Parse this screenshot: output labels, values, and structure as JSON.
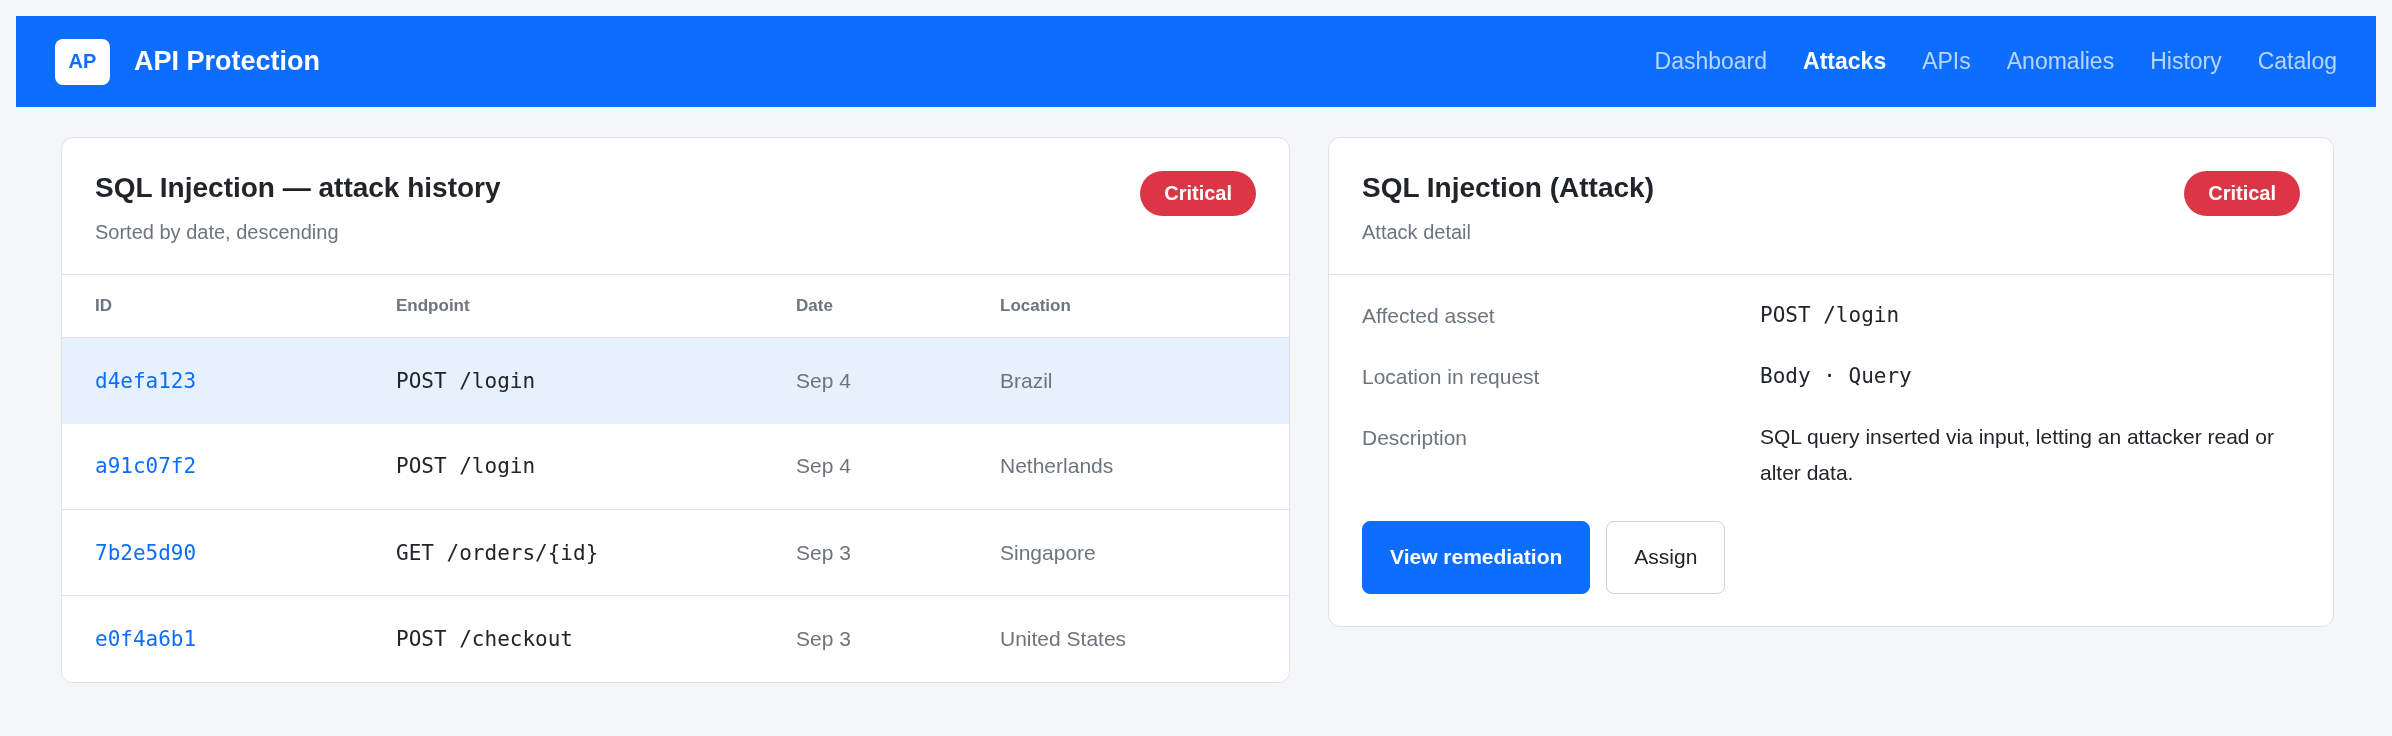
{
  "header": {
    "logo": "AP",
    "title": "API Protection",
    "nav": [
      {
        "label": "Dashboard",
        "selected": false
      },
      {
        "label": "Attacks",
        "selected": true
      },
      {
        "label": "APIs",
        "selected": false
      },
      {
        "label": "Anomalies",
        "selected": false
      },
      {
        "label": "History",
        "selected": false
      },
      {
        "label": "Catalog",
        "selected": false
      }
    ]
  },
  "history": {
    "title": "SQL Injection — attack history",
    "subtitle": "Sorted by date, descending",
    "badge": "Critical",
    "table": {
      "columns": [
        "ID",
        "Endpoint",
        "Date",
        "Location"
      ],
      "rows": [
        {
          "id": "d4efa123",
          "endpoint": "POST /login",
          "date": "Sep 4",
          "location": "Brazil",
          "selected": true
        },
        {
          "id": "a91c07f2",
          "endpoint": "POST /login",
          "date": "Sep 4",
          "location": "Netherlands",
          "selected": false
        },
        {
          "id": "7b2e5d90",
          "endpoint": "GET /orders/{id}",
          "date": "Sep 3",
          "location": "Singapore",
          "selected": false
        },
        {
          "id": "e0f4a6b1",
          "endpoint": "POST /checkout",
          "date": "Sep 3",
          "location": "United States",
          "selected": false
        }
      ]
    }
  },
  "detail": {
    "title": "SQL Injection (Attack)",
    "subtitle": "Attack detail",
    "badge": "Critical",
    "fields": [
      {
        "label": "Affected asset",
        "value": "POST /login",
        "kind": "code"
      },
      {
        "label": "Location in request",
        "value": "Body · Query",
        "kind": "code"
      },
      {
        "label": "Description",
        "value": "SQL query inserted via input, letting an attacker read or alter data.",
        "kind": "text"
      }
    ],
    "buttons": [
      {
        "label": "View remediation",
        "kind": "primary"
      },
      {
        "label": "Assign",
        "kind": "secondary"
      }
    ]
  }
}
